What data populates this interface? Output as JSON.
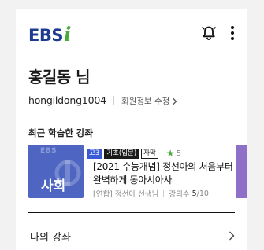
{
  "header": {
    "logo_text": "EBS",
    "logo_accent": "i"
  },
  "user": {
    "name": "홍길동 님",
    "id": "hongildong1004",
    "edit_label": "회원정보 수정"
  },
  "recent": {
    "section_label": "최근 학습한 강좌",
    "course": {
      "thumb_logo": "EBS",
      "subject": "사회",
      "grade_badge": "고3",
      "level_badge": "기초(입문)",
      "subtitle_badge": "자막",
      "rating": "5",
      "title": "[2021 수능개념] 정선아의 처음부터 완벽하게 동아시아사",
      "provider": "[연합] 정선아 선생님",
      "progress_label": "강의수",
      "progress_current": "5",
      "progress_total": "/10"
    }
  },
  "menu": {
    "my_courses": "나의 강좌"
  },
  "colors": {
    "brand_blue": "#1d3b8f",
    "brand_green": "#4aaa3b",
    "thumb_blue": "#4e66c2",
    "next_card_purple": "#8e70c8",
    "grade_badge_blue": "#3b5bd6"
  },
  "icons": {
    "notification": "bell-icon",
    "more": "more-vertical-icon",
    "chevron": "chevron-right-icon",
    "star": "star-icon"
  }
}
